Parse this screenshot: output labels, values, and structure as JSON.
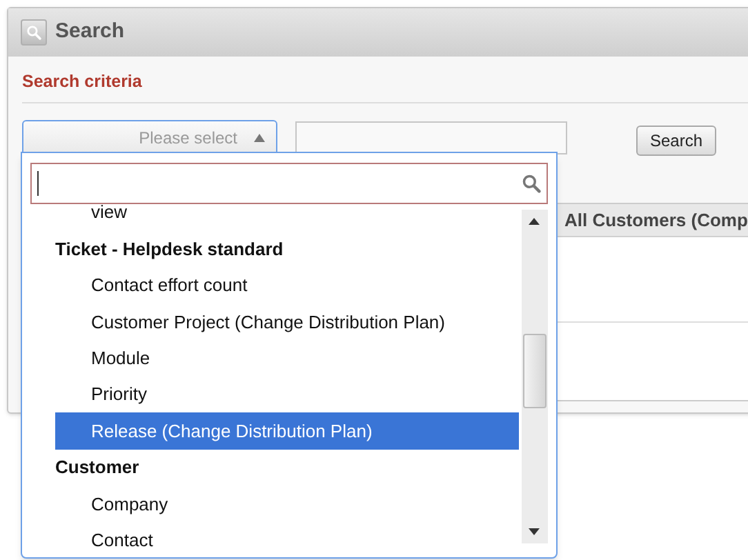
{
  "panel": {
    "title": "Search"
  },
  "section": {
    "title": "Search criteria"
  },
  "select": {
    "placeholder": "Please select",
    "expanded": true
  },
  "search_button": "Search",
  "table": {
    "column_header": "All Customers (Comp"
  },
  "dropdown": {
    "items": [
      {
        "kind": "option",
        "label": "view",
        "selected": false
      },
      {
        "kind": "group",
        "label": "Ticket - Helpdesk standard"
      },
      {
        "kind": "option",
        "label": "Contact effort count",
        "selected": false
      },
      {
        "kind": "option",
        "label": "Customer Project (Change Distribution Plan)",
        "selected": false
      },
      {
        "kind": "option",
        "label": "Module",
        "selected": false
      },
      {
        "kind": "option",
        "label": "Priority",
        "selected": false
      },
      {
        "kind": "option",
        "label": "Release (Change Distribution Plan)",
        "selected": true
      },
      {
        "kind": "group",
        "label": "Customer"
      },
      {
        "kind": "option",
        "label": "Company",
        "selected": false
      },
      {
        "kind": "option",
        "label": "Contact",
        "selected": false
      }
    ]
  }
}
